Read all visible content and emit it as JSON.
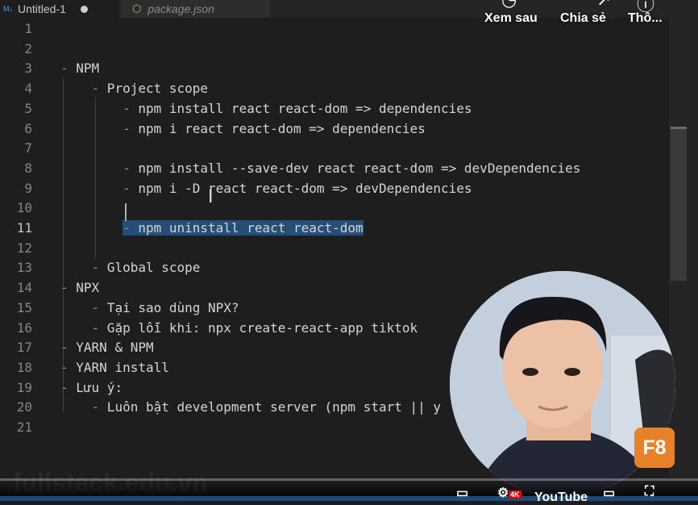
{
  "tabs": [
    {
      "label": "Untitled-1",
      "icon": "markdown-icon"
    },
    {
      "label": "package.json",
      "icon": "nodejs-icon"
    }
  ],
  "editor": {
    "lines": [
      {
        "num": "1",
        "text": ""
      },
      {
        "num": "2",
        "text": ""
      },
      {
        "num": "3",
        "text": "- NPM"
      },
      {
        "num": "4",
        "text": "    - Project scope"
      },
      {
        "num": "5",
        "text": "        - npm install react react-dom => dependencies"
      },
      {
        "num": "6",
        "text": "        - npm i react react-dom => dependencies"
      },
      {
        "num": "7",
        "text": ""
      },
      {
        "num": "8",
        "text": "        - npm install --save-dev react react-dom => devDependencies"
      },
      {
        "num": "9",
        "text": "        - npm i -D react react-dom => devDependencies"
      },
      {
        "num": "10",
        "text": ""
      },
      {
        "num": "11",
        "text": "        - npm uninstall react react-dom"
      },
      {
        "num": "12",
        "text": ""
      },
      {
        "num": "13",
        "text": "    - Global scope"
      },
      {
        "num": "14",
        "text": "- NPX"
      },
      {
        "num": "15",
        "text": "    - Tại sao dùng NPX?"
      },
      {
        "num": "16",
        "text": "    - Gặp lỗi khi: npx create-react-app tiktok"
      },
      {
        "num": "17",
        "text": "- YARN & NPM"
      },
      {
        "num": "18",
        "text": "- YARN install"
      },
      {
        "num": "19",
        "text": "- Lưu ý:"
      },
      {
        "num": "20",
        "text": "    - Luôn bật development server (npm start || y"
      },
      {
        "num": "21",
        "text": ""
      }
    ]
  },
  "youtube": {
    "actions": [
      {
        "label": "Xem sau",
        "icon": "clock-icon"
      },
      {
        "label": "Chia sẻ",
        "icon": "share-icon"
      },
      {
        "label": "Thô...",
        "icon": "info-icon"
      }
    ],
    "badge": "F8",
    "watermark": "fullstack.edu.vn",
    "logo": "YouTube",
    "quality_badge": "4K"
  }
}
